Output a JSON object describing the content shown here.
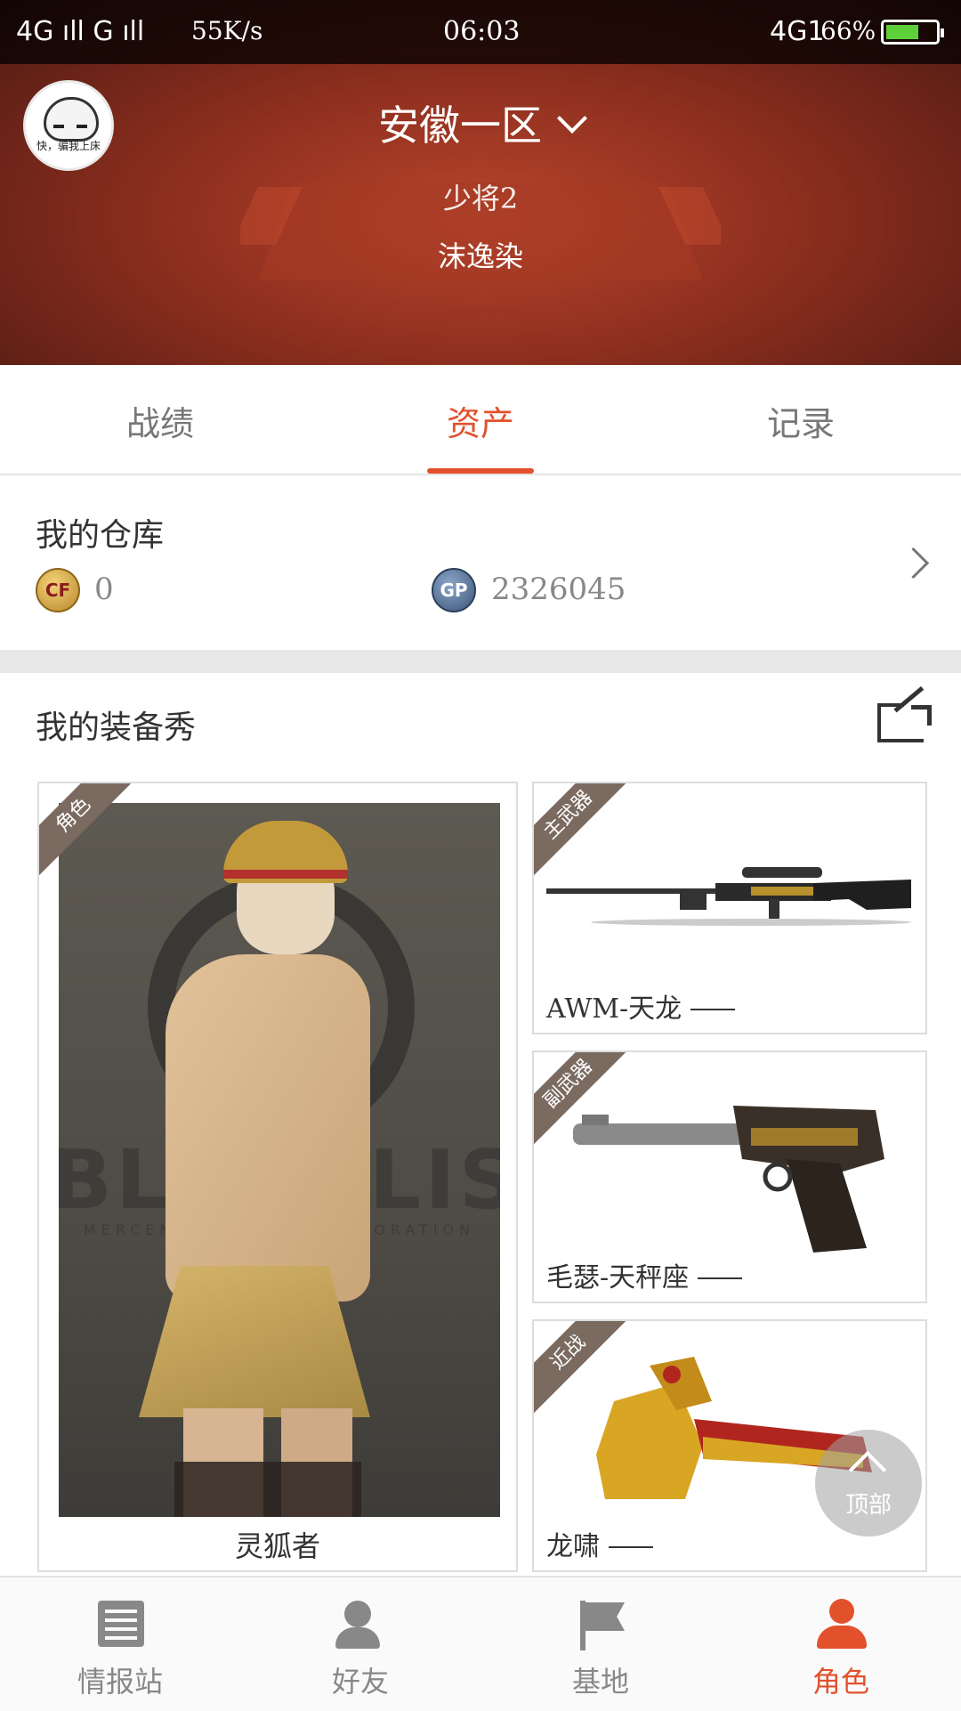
{
  "status_bar": {
    "left_signal": "4G ıll G ıll",
    "speed": "55K/s",
    "time": "06:03",
    "right_signal": "4G1",
    "battery": "66%",
    "battery_level": 0.66
  },
  "header": {
    "server": "安徽一区",
    "rank": "少将2",
    "nickname": "沫逸染",
    "avatar_text": "快，骗我上床"
  },
  "tabs": [
    {
      "label": "战绩",
      "active": false
    },
    {
      "label": "资产",
      "active": true
    },
    {
      "label": "记录",
      "active": false
    }
  ],
  "warehouse": {
    "title": "我的仓库",
    "cf_icon": "CF",
    "cf_value": "0",
    "gp_icon": "GP",
    "gp_value": "2326045"
  },
  "equipment": {
    "title": "我的装备秀",
    "character": {
      "tag": "角色",
      "name": "灵狐者",
      "bg_text": "BLACKLIST",
      "bg_sub": "MERCENARY FORCE CORPORATION"
    },
    "primary": {
      "tag": "主武器",
      "name": "AWM-天龙"
    },
    "secondary": {
      "tag": "副武器",
      "name": "毛瑟-天秤座"
    },
    "melee": {
      "tag": "近战",
      "name": "龙啸"
    }
  },
  "back_to_top": "顶部",
  "bottom_nav": [
    {
      "label": "情报站",
      "icon": "news-icon",
      "active": false
    },
    {
      "label": "好友",
      "icon": "friends-icon",
      "active": false
    },
    {
      "label": "基地",
      "icon": "flag-icon",
      "active": false
    },
    {
      "label": "角色",
      "icon": "role-icon",
      "active": true
    }
  ],
  "colors": {
    "accent": "#e2512c",
    "header_red": "#8e2f1f"
  }
}
